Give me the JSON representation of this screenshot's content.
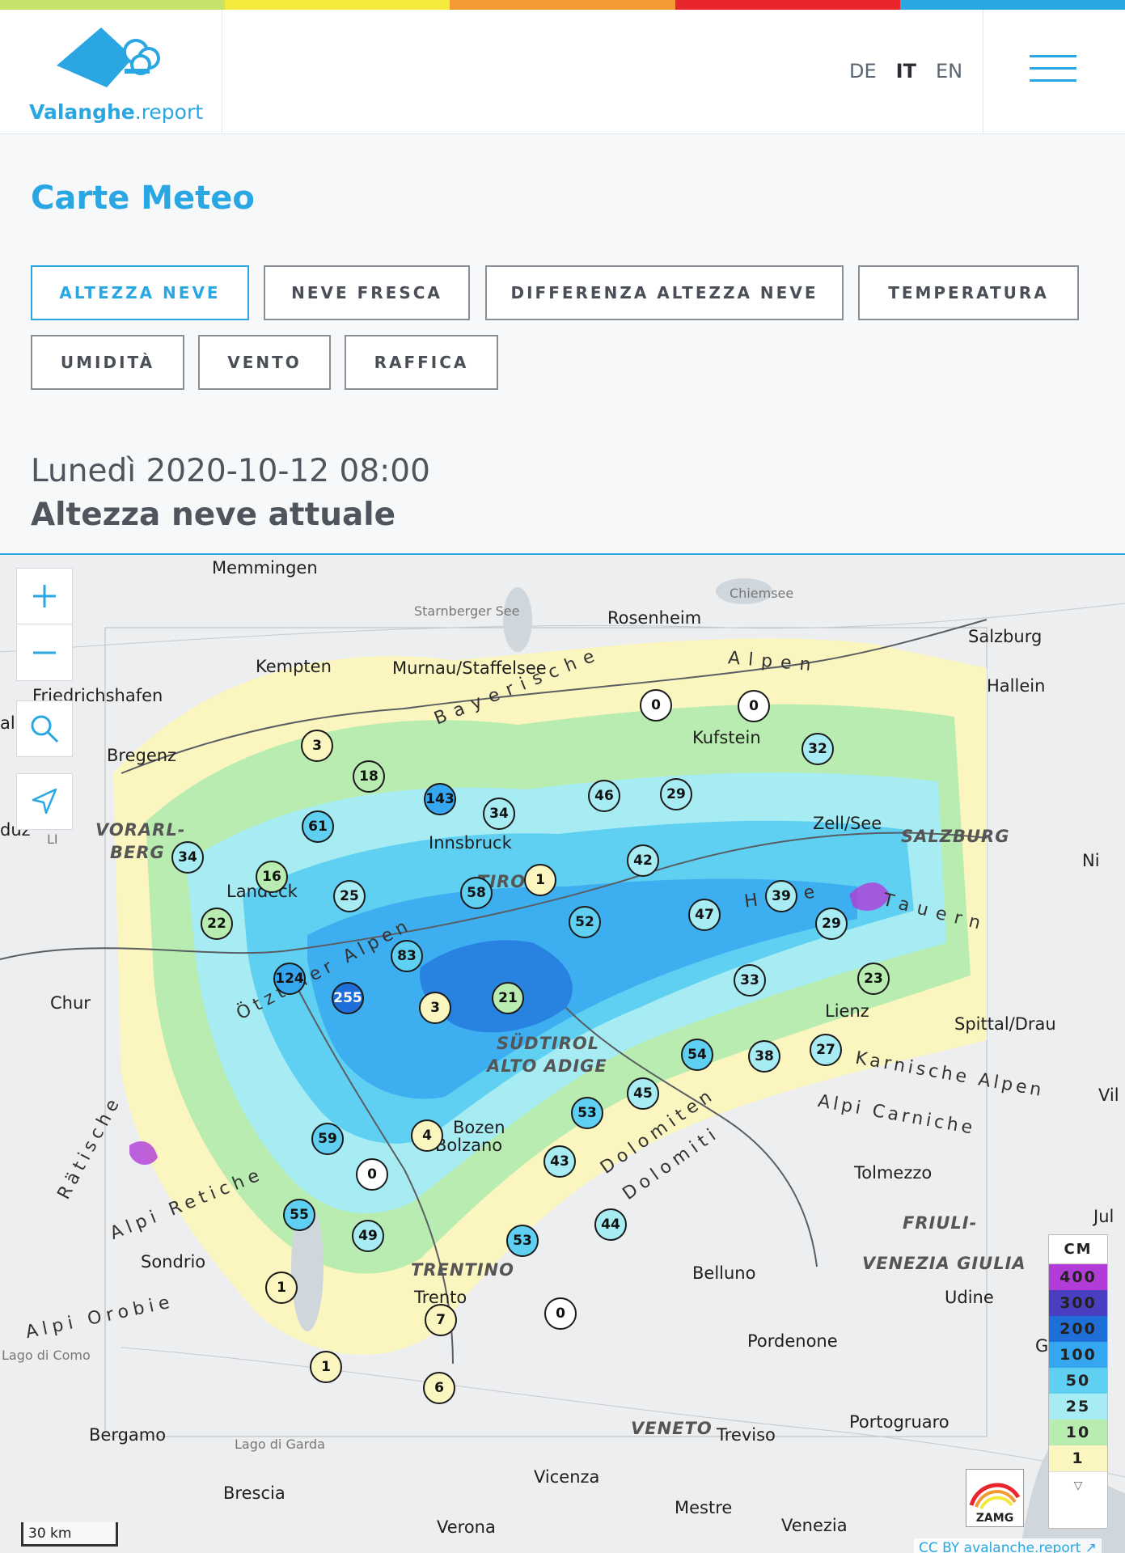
{
  "site": {
    "topbar_colors": [
      "#c7e26b",
      "#f4ea3b",
      "#f49a35",
      "#e8262c",
      "#2aa7e2"
    ],
    "logo_text_bold": "Valanghe",
    "logo_text_thin": ".report",
    "languages": [
      "DE",
      "IT",
      "EN"
    ],
    "active_language": "IT",
    "accent": "#2aa7e2"
  },
  "page": {
    "title": "Carte Meteo",
    "tabs": [
      "ALTEZZA NEVE",
      "NEVE FRESCA",
      "DIFFERENZA ALTEZZA NEVE",
      "TEMPERATURA",
      "UMIDITÀ",
      "VENTO",
      "RAFFICA"
    ],
    "active_tab": "ALTEZZA NEVE",
    "date_line": "Lunedì 2020-10-12 08:00",
    "map_heading": "Altezza neve attuale"
  },
  "map": {
    "controls": [
      "zoom-in",
      "zoom-out",
      "search",
      "locate"
    ],
    "places": [
      "Memmingen",
      "Starnberger See",
      "Chiemsee",
      "Rosenheim",
      "Salzburg",
      "Kempten",
      "Murnau/Staffelsee",
      "Hallein",
      "Friedrichshafen",
      "Kufstein",
      "Bregenz",
      "Innsbruck",
      "Zell/See",
      "Landeck",
      "Chur",
      "Lienz",
      "Spittal/Drau",
      "Bozen",
      "Bolzano",
      "Tolmezzo",
      "Sondrio",
      "Trento",
      "Belluno",
      "Udine",
      "Pordenone",
      "Portogruaro",
      "Bergamo",
      "Lago di Garda",
      "Treviso",
      "Brescia",
      "Vicenza",
      "Mestre",
      "Venezia",
      "Verona",
      "Lago di Como",
      "allen",
      "duz",
      "LI",
      "Vil",
      "Ni",
      "Jul",
      "G"
    ],
    "regions": [
      "VORARL-",
      "BERG",
      "TIROL",
      "SALZBURG",
      "SÜDTIROL",
      "ALTO ADIGE",
      "TRENTINO",
      "FRIULI-",
      "VENEZIA GIULIA",
      "VENETO"
    ],
    "ranges": [
      "Bayerische",
      "Alpen",
      "Hohe",
      "Tauern",
      "Karnische Alpen",
      "Alpi Carniche",
      "Dolomiten",
      "Dolomiti",
      "Alpi Retiche",
      "Rätische",
      "Ötztaler Alpen",
      "Alpi Orobie"
    ],
    "stations": [
      {
        "v": 3
      },
      {
        "v": 18
      },
      {
        "v": 143
      },
      {
        "v": 34
      },
      {
        "v": 0
      },
      {
        "v": 0
      },
      {
        "v": 32
      },
      {
        "v": 46
      },
      {
        "v": 29
      },
      {
        "v": 61
      },
      {
        "v": 34
      },
      {
        "v": 16
      },
      {
        "v": 25
      },
      {
        "v": 58
      },
      {
        "v": 1
      },
      {
        "v": 42
      },
      {
        "v": 22
      },
      {
        "v": 52
      },
      {
        "v": 47
      },
      {
        "v": 39
      },
      {
        "v": 29
      },
      {
        "v": 83
      },
      {
        "v": 124
      },
      {
        "v": 255
      },
      {
        "v": 3
      },
      {
        "v": 21
      },
      {
        "v": 33
      },
      {
        "v": 23
      },
      {
        "v": 54
      },
      {
        "v": 38
      },
      {
        "v": 27
      },
      {
        "v": 45
      },
      {
        "v": 53
      },
      {
        "v": 59
      },
      {
        "v": 4
      },
      {
        "v": 0
      },
      {
        "v": 43
      },
      {
        "v": 55
      },
      {
        "v": 49
      },
      {
        "v": 53
      },
      {
        "v": 44
      },
      {
        "v": 1
      },
      {
        "v": 0
      },
      {
        "v": 7
      },
      {
        "v": 1
      },
      {
        "v": 6
      }
    ],
    "legend": {
      "title": "CM",
      "steps": [
        {
          "label": "400",
          "color": "#b23cd8"
        },
        {
          "label": "300",
          "color": "#4a3fc0"
        },
        {
          "label": "200",
          "color": "#1f6fd9"
        },
        {
          "label": "100",
          "color": "#35a6f0"
        },
        {
          "label": "50",
          "color": "#5fd0f2"
        },
        {
          "label": "25",
          "color": "#a6ecf2"
        },
        {
          "label": "10",
          "color": "#b9ecb0"
        },
        {
          "label": "1",
          "color": "#fbf6bf"
        }
      ]
    },
    "zamg_label": "ZAMG",
    "scale_label": "30 km",
    "attribution": "CC BY avalanche.report ↗"
  }
}
